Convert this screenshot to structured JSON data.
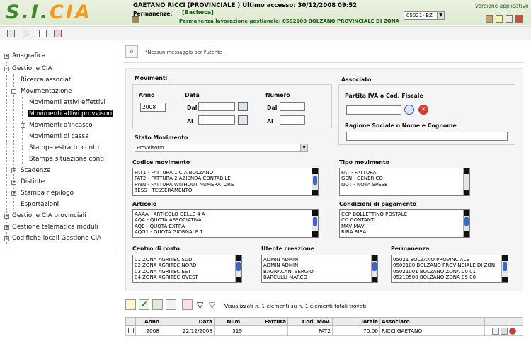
{
  "header": {
    "logo_text": "S.I.",
    "logo_accent": "CIA",
    "user_line": "GAETANO RICCI (PROVINCIALE ) Ultimo accesso: 30/12/2008 09:52",
    "permanenze_label": "Permanenze:",
    "permanenze_value": "[Bacheca]",
    "permanenza_line": "Permanenza lavorazione gestionale: 0502100 BOLZANO PROVINCIALE DI ZONA",
    "selector_value": "05021) BZ",
    "version_link": "Versione applicativo"
  },
  "sidebar": {
    "items": [
      {
        "label": "Anagrafica",
        "level": 0,
        "expander": "+"
      },
      {
        "label": "Gestione CIA",
        "level": 0,
        "expander": "-"
      },
      {
        "label": "Ricerca associati",
        "level": 1
      },
      {
        "label": "Movimentazione",
        "level": 1,
        "expander": "-"
      },
      {
        "label": "Movimenti attivi effettivi",
        "level": 2
      },
      {
        "label": "Movimenti attivi provvisori",
        "level": 2,
        "selected": true
      },
      {
        "label": "Movimenti d'incasso",
        "level": 2,
        "expander": "+"
      },
      {
        "label": "Movimenti di cassa",
        "level": 2
      },
      {
        "label": "Stampa estratto conto",
        "level": 2
      },
      {
        "label": "Stampa situazione conti",
        "level": 2
      },
      {
        "label": "Scadenze",
        "level": 1,
        "expander": "+"
      },
      {
        "label": "Distinte",
        "level": 1,
        "expander": "+"
      },
      {
        "label": "Stampa riepilogo",
        "level": 1,
        "expander": "+"
      },
      {
        "label": "Esportazioni",
        "level": 1
      },
      {
        "label": "Gestione CIA provinciali",
        "level": 0,
        "expander": "+"
      },
      {
        "label": "Gestione telematica moduli",
        "level": 0,
        "expander": "+"
      },
      {
        "label": "Codifiche locali Gestione CIA",
        "level": 0,
        "expander": "+"
      }
    ]
  },
  "message": {
    "text": "*Nessun messaggio per l'utente"
  },
  "movimenti": {
    "title": "Movimenti",
    "anno_label": "Anno",
    "anno_value": "2008",
    "data_label": "Data",
    "numero_label": "Numero",
    "dal_label": "Dal",
    "al_label": "Al"
  },
  "associato": {
    "title": "Associato",
    "piva_label": "Partita IVA o Cod. Fiscale",
    "ragione_label": "Ragione Sociale o Nome e Cognome"
  },
  "stato": {
    "label": "Stato Movimento",
    "value": "Provvisorio"
  },
  "codice_movimento": {
    "label": "Codice movimento",
    "options": [
      "FAT1 - FATTURA 1 CIA BOLZANO",
      "FAT2 - FATTURA 2 AZIENDA CONTABILE",
      "FWN - FATTURA WITHOUT NUMERATORE",
      "TESS - TESSERAMENTO"
    ]
  },
  "tipo_movimento": {
    "label": "Tipo movimento",
    "options": [
      "FAT - FATTURA",
      "GEN - GENERICO",
      "NOT - NOTA SPESE"
    ]
  },
  "articolo": {
    "label": "Articolo",
    "options": [
      "AAAA - ARTICOLO DELLE 4 A",
      "AQA - QUOTA ASSOCIATIVA",
      "AQE - QUOTA EXTRA",
      "AQG1 - QUOTA GIORNALE 1"
    ]
  },
  "condizioni": {
    "label": "Condizioni di pagamento",
    "options": [
      "CCP BOLLETTINO POSTALE",
      "CO CONTANTI",
      "MAV MAV",
      "RIBA RIBA"
    ]
  },
  "centro_costo": {
    "label": "Centro di costo",
    "options": [
      "01 ZONA AGRITEC SUD",
      "02 ZONA AGRITEC NORD",
      "03 ZONA AGRITEC EST",
      "04 ZONA AGRITEC OVEST"
    ]
  },
  "utente_creazione": {
    "label": "Utente creazione",
    "options": [
      "ADMIN ADMIN",
      "ADMIN ADMIN",
      "BAGNACANI SERGIO",
      "BARCULLI MARCO"
    ]
  },
  "permanenza": {
    "label": "Permanenza",
    "options": [
      "05021 BOLZANO PROVINCIALE",
      "0502100 BOLZANO PROVINCIALE DI ZON",
      "05021001 BOLZANO ZONA 00 01",
      "05210500 BOLZANO ZONA 05 00"
    ]
  },
  "results": {
    "summary": "Visualizzati n. 1 elementi su n. 1 elementi totali trovati",
    "columns": [
      "Anno",
      "Data",
      "Num.",
      "Fattura",
      "Cod. Mov.",
      "Totale",
      "Associato"
    ],
    "rows": [
      {
        "anno": "2008",
        "data": "22/12/2008",
        "num": "519",
        "fattura": "",
        "cod_mov": "FAT2",
        "totale": "70,00",
        "associato": "RICCI GAETANO"
      }
    ]
  },
  "colors": {
    "header_bg": "#e3eed8",
    "logo_green": "#3d8a2c",
    "logo_orange": "#f39c1a",
    "scroll_thumb": "#3767c9"
  }
}
